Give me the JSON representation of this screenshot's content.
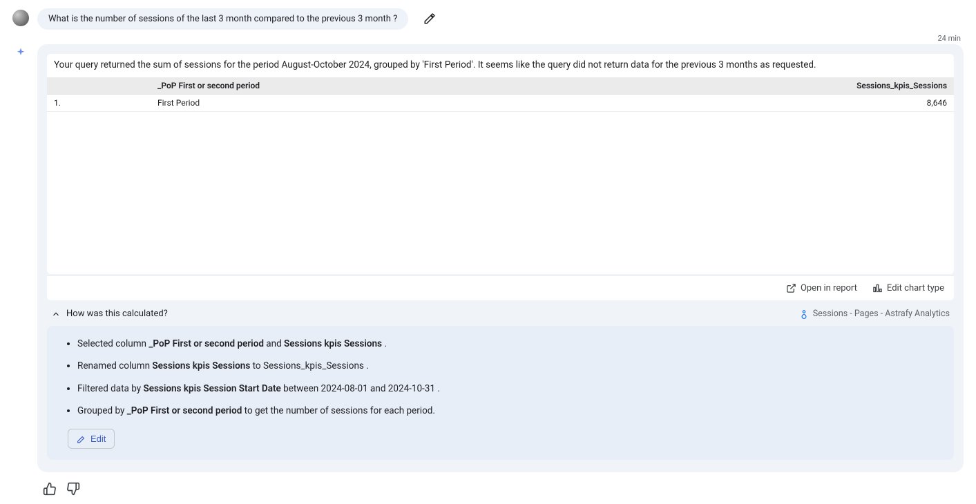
{
  "user_query": "What is the number of sessions of the last 3 month compared to the previous 3 month ?",
  "timestamp": "24 min",
  "summary": "Your query returned the sum of sessions for the period August-October 2024, grouped by 'First Period'. It seems like the query did not return data for the previous 3 months as requested.",
  "table": {
    "headers": {
      "period": "_PoP First or second period",
      "sessions": "Sessions_kpis_Sessions"
    },
    "rows": [
      {
        "idx": "1.",
        "period": "First Period",
        "sessions": "8,646"
      }
    ]
  },
  "actions": {
    "open_in_report": "Open in report",
    "edit_chart_type": "Edit chart type"
  },
  "calc_toggle": "How was this calculated?",
  "source": "Sessions - Pages - Astrafy Analytics",
  "calculation": {
    "step1_prefix": "Selected column ",
    "step1_bold1": "_PoP First or second period",
    "step1_mid": " and ",
    "step1_bold2": "Sessions kpis Sessions",
    "step1_suffix": " .",
    "step2_prefix": "Renamed column ",
    "step2_bold": "Sessions kpis Sessions",
    "step2_suffix": " to Sessions_kpis_Sessions .",
    "step3_prefix": "Filtered data by ",
    "step3_bold": "Sessions kpis Session Start Date",
    "step3_suffix": " between 2024-08-01 and 2024-10-31 .",
    "step4_prefix": "Grouped by ",
    "step4_bold": "_PoP First or second period",
    "step4_suffix": " to get the number of sessions for each period."
  },
  "edit_button": "Edit"
}
